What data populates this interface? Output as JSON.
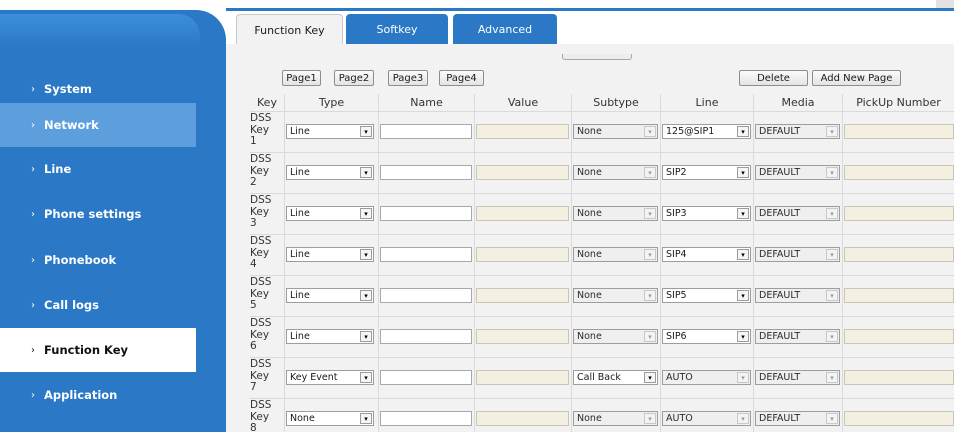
{
  "sidebar": {
    "items": [
      {
        "label": "System",
        "arrow": "›"
      },
      {
        "label": "Network",
        "arrow": "›"
      },
      {
        "label": "Line",
        "arrow": "›"
      },
      {
        "label": "Phone settings",
        "arrow": "›"
      },
      {
        "label": "Phonebook",
        "arrow": "›"
      },
      {
        "label": "Call logs",
        "arrow": "›"
      },
      {
        "label": "Function Key",
        "arrow": "›"
      },
      {
        "label": "Application",
        "arrow": "›"
      }
    ]
  },
  "tabs": [
    {
      "label": "Function Key"
    },
    {
      "label": "Softkey"
    },
    {
      "label": "Advanced"
    }
  ],
  "pages": [
    {
      "label": "Page1"
    },
    {
      "label": "Page2"
    },
    {
      "label": "Page3"
    },
    {
      "label": "Page4"
    }
  ],
  "actions": {
    "delete": "Delete",
    "add_new_page": "Add New Page"
  },
  "table": {
    "headers": {
      "key": "Key",
      "type": "Type",
      "name": "Name",
      "value": "Value",
      "subtype": "Subtype",
      "line": "Line",
      "media": "Media",
      "pickup": "PickUp Number"
    },
    "rows": [
      {
        "k1": "DSS",
        "k2": "Key",
        "k3": "1",
        "type": "Line",
        "subtype": "None",
        "line": "125@SIP1",
        "media": "DEFAULT"
      },
      {
        "k1": "DSS",
        "k2": "Key",
        "k3": "2",
        "type": "Line",
        "subtype": "None",
        "line": "SIP2",
        "media": "DEFAULT"
      },
      {
        "k1": "DSS",
        "k2": "Key",
        "k3": "3",
        "type": "Line",
        "subtype": "None",
        "line": "SIP3",
        "media": "DEFAULT"
      },
      {
        "k1": "DSS",
        "k2": "Key",
        "k3": "4",
        "type": "Line",
        "subtype": "None",
        "line": "SIP4",
        "media": "DEFAULT"
      },
      {
        "k1": "DSS",
        "k2": "Key",
        "k3": "5",
        "type": "Line",
        "subtype": "None",
        "line": "SIP5",
        "media": "DEFAULT"
      },
      {
        "k1": "DSS",
        "k2": "Key",
        "k3": "6",
        "type": "Line",
        "subtype": "None",
        "line": "SIP6",
        "media": "DEFAULT"
      },
      {
        "k1": "DSS",
        "k2": "Key",
        "k3": "7",
        "type": "Key Event",
        "subtype": "Call Back",
        "line": "AUTO",
        "media": "DEFAULT"
      },
      {
        "k1": "DSS",
        "k2": "Key",
        "k3": "8",
        "type": "None",
        "subtype": "None",
        "line": "AUTO",
        "media": "DEFAULT"
      }
    ]
  },
  "colors": {
    "sidebar": "#2a78c6",
    "active_tab": "#f2f2f2",
    "readonly_field": "#f3f0e2"
  },
  "icons": {
    "caret": "▾",
    "nav_arrow": "›"
  }
}
